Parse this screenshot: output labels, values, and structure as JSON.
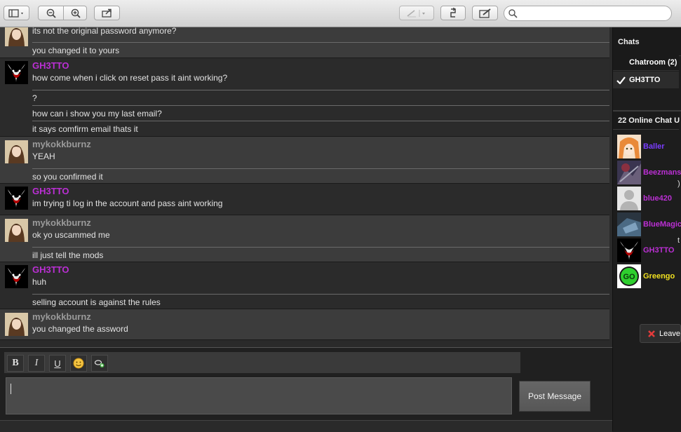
{
  "toolbar": {
    "search_placeholder": ""
  },
  "messages": [
    {
      "user": "",
      "avatar": "girl-avatar",
      "style": "alt",
      "lines": [
        "its not the original password anymore?",
        "you changed it to yours"
      ]
    },
    {
      "user": "GH3TTO",
      "avatar": "mask-avatar",
      "style": "dark",
      "lines": [
        "how come when i click on reset pass it aint working?",
        "?",
        "how can i show you my last email?",
        "it says comfirm email thats it"
      ]
    },
    {
      "user": "mykokkburnz",
      "avatar": "girl-avatar",
      "style": "alt",
      "lines": [
        "YEAH",
        "so you confirmed it"
      ]
    },
    {
      "user": "GH3TTO",
      "avatar": "mask-avatar",
      "style": "dark",
      "lines": [
        "im trying ti log in the account and pass aint working"
      ]
    },
    {
      "user": "mykokkburnz",
      "avatar": "girl-avatar",
      "style": "alt",
      "lines": [
        "ok yo uscammed me",
        "ill just tell the mods"
      ]
    },
    {
      "user": "GH3TTO",
      "avatar": "mask-avatar",
      "style": "dark",
      "lines": [
        "huh",
        "selling account is against the rules"
      ]
    },
    {
      "user": "mykokkburnz",
      "avatar": "girl-avatar",
      "style": "alt",
      "lines": [
        "you changed the assword"
      ]
    }
  ],
  "sidebar": {
    "chats_heading": "Chats",
    "rooms": [
      {
        "label": "Chatroom (2)",
        "checked": false
      },
      {
        "label": "GH3TTO",
        "checked": true
      }
    ],
    "online_heading": "22 Online Chat U",
    "online_users": [
      {
        "name": "Baller",
        "color": "#7a3cff",
        "avatar": "anime-avatar"
      },
      {
        "name": "Beezmans",
        "color": "#bb2fd4",
        "avatar": "dark-avatar"
      },
      {
        "name": "blue420",
        "color": "#bb2fd4",
        "avatar": "default-avatar"
      },
      {
        "name": "BlueMagic",
        "color": "#bb2fd4",
        "avatar": "blue-avatar"
      },
      {
        "name": "GH3TTO",
        "color": "#bb2fd4",
        "avatar": "mask-avatar"
      },
      {
        "name": "Greengo",
        "color": "#f0e020",
        "avatar": "go-avatar"
      }
    ],
    "leave_label": "Leave",
    "edge_glyph_1": ")",
    "edge_glyph_2": "t"
  },
  "composer": {
    "bold": "B",
    "italic": "I",
    "underline": "U",
    "post_label": "Post Message",
    "input_value": ""
  }
}
